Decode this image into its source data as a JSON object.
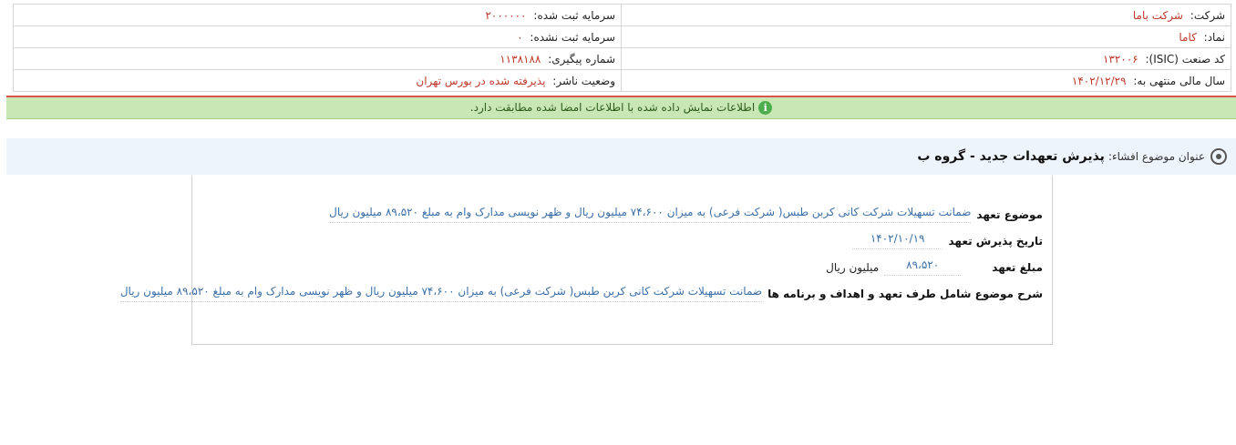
{
  "header": {
    "rows": [
      {
        "right_label": "شرکت:",
        "right_value": "شرکت باما",
        "left_label": "سرمایه ثبت شده:",
        "left_value": "۲۰۰۰۰۰۰"
      },
      {
        "right_label": "نماد:",
        "right_value": "کاما",
        "left_label": "سرمایه ثبت نشده:",
        "left_value": "۰"
      },
      {
        "right_label": "کد صنعت (ISIC):",
        "right_value": "۱۳۲۰۰۶",
        "left_label": "شماره پیگیری:",
        "left_value": "۱۱۳۸۱۸۸"
      },
      {
        "right_label": "سال مالی منتهی به:",
        "right_value": "۱۴۰۲/۱۲/۲۹",
        "left_label": "وضعیت ناشر:",
        "left_value": "پذیرفته شده در بورس تهران"
      }
    ]
  },
  "notice": {
    "icon": "info-icon",
    "icon_glyph": "i",
    "text": "اطلاعات نمایش داده شده با اطلاعات امضا شده مطابقت دارد."
  },
  "subject": {
    "label": "عنوان موضوع افشاء:",
    "title": "پذیرش تعهدات جدید - گروه ب"
  },
  "details": {
    "topic_label": "موضوع تعهد",
    "topic_value": "ضمانت تسهیلات شرکت کانی کربن طبس( شرکت فرعی) به میزان ۷۴،۶۰۰ میلیون ریال و ظهر نویسی مدارک وام به مبلغ ۸۹،۵۲۰ میلیون ریال",
    "date_label": "تاریخ پذیرش تعهد",
    "date_value": "۱۴۰۲/۱۰/۱۹",
    "amount_label": "مبلغ تعهد",
    "amount_value": "۸۹،۵۲۰",
    "amount_unit": "میلیون ریال",
    "desc_label": "شرح موضوع شامل طرف تعهد و اهداف و برنامه ها",
    "desc_value": "ضمانت تسهیلات شرکت کانی کربن طبس( شرکت فرعی) به میزان ۷۴،۶۰۰ میلیون ریال و ظهر نویسی مدارک وام به مبلغ ۸۹،۵۲۰ میلیون ریال"
  },
  "colors": {
    "value_red": "#c0392b",
    "value_blue": "#3b6fa8",
    "notice_green": "#c9e6b5",
    "subject_bg": "#eef4fb"
  }
}
